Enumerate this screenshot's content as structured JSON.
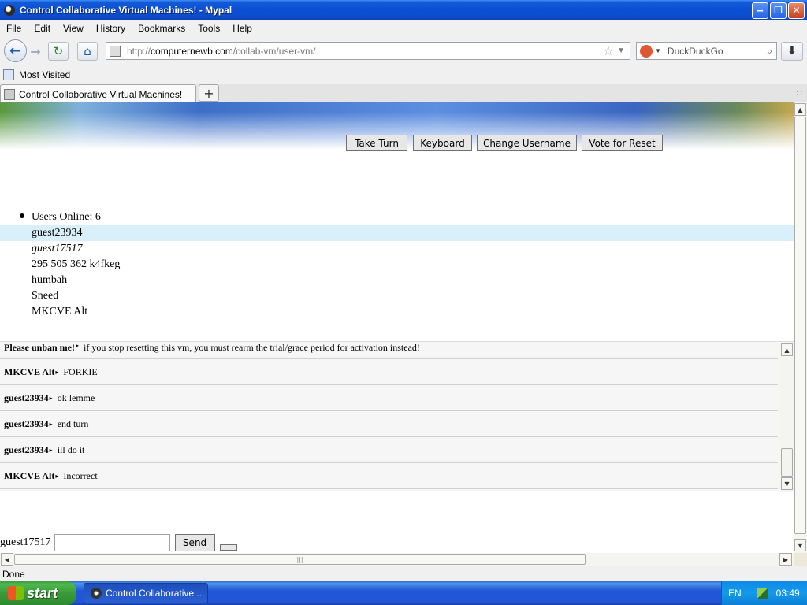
{
  "window": {
    "title": "Control Collaborative Virtual Machines! - Mypal",
    "min_glyph": "‒",
    "max_glyph": "❐",
    "close_glyph": "✕"
  },
  "menu": [
    "File",
    "Edit",
    "View",
    "History",
    "Bookmarks",
    "Tools",
    "Help"
  ],
  "nav": {
    "back_glyph": "←",
    "forward_glyph": "→",
    "reload_glyph": "↻",
    "home_glyph": "⌂",
    "url_scheme": "http://",
    "url_host": "computernewb.com",
    "url_path": "/collab-vm/user-vm/",
    "star_glyph": "☆",
    "dropdown_glyph": "▼",
    "search_placeholder": "DuckDuckGo",
    "search_glyph": "⌕",
    "download_glyph": "⬇"
  },
  "bookmarks": {
    "most_visited": "Most Visited"
  },
  "tabs": [
    {
      "label": "Control Collaborative Virtual Machines!"
    }
  ],
  "tabbar": {
    "new_tab": "+",
    "menu_glyph": "∷"
  },
  "vm_controls": {
    "take_turn": "Take Turn",
    "keyboard": "Keyboard",
    "change_username": "Change Username",
    "vote_reset": "Vote for Reset"
  },
  "users": {
    "header": "Users Online: 6",
    "list": [
      "guest23934",
      "guest17517",
      "295 505 362 k4fkeg",
      "humbah",
      "Sneed",
      "MKCVE Alt"
    ]
  },
  "chat": {
    "messages": [
      {
        "user": "Please unban me!",
        "text": "if you stop resetting this vm, you must rearm the trial/grace period for activation instead!"
      },
      {
        "user": "MKCVE Alt",
        "text": "FORKIE"
      },
      {
        "user": "guest23934",
        "text": "ok lemme"
      },
      {
        "user": "guest23934",
        "text": "end turn"
      },
      {
        "user": "guest23934",
        "text": "ill do it"
      },
      {
        "user": "MKCVE Alt",
        "text": "Incorrect"
      }
    ],
    "arrow": "▸",
    "username": "guest17517",
    "input_value": "",
    "send_label": "Send"
  },
  "scroll": {
    "up": "▲",
    "down": "▼",
    "left": "◀",
    "right": "▶",
    "grip": "|||",
    "vgrip": "≡"
  },
  "status": {
    "text": "Done"
  },
  "taskbar": {
    "start": "start",
    "task_label": "Control Collaborative ...",
    "lang": "EN",
    "clock": "03:49"
  },
  "colors": {
    "titlebar": "#0a4fd4",
    "highlight_row": "#d9f0fa",
    "taskbar": "#2157d7",
    "start": "#3a9a3a"
  }
}
